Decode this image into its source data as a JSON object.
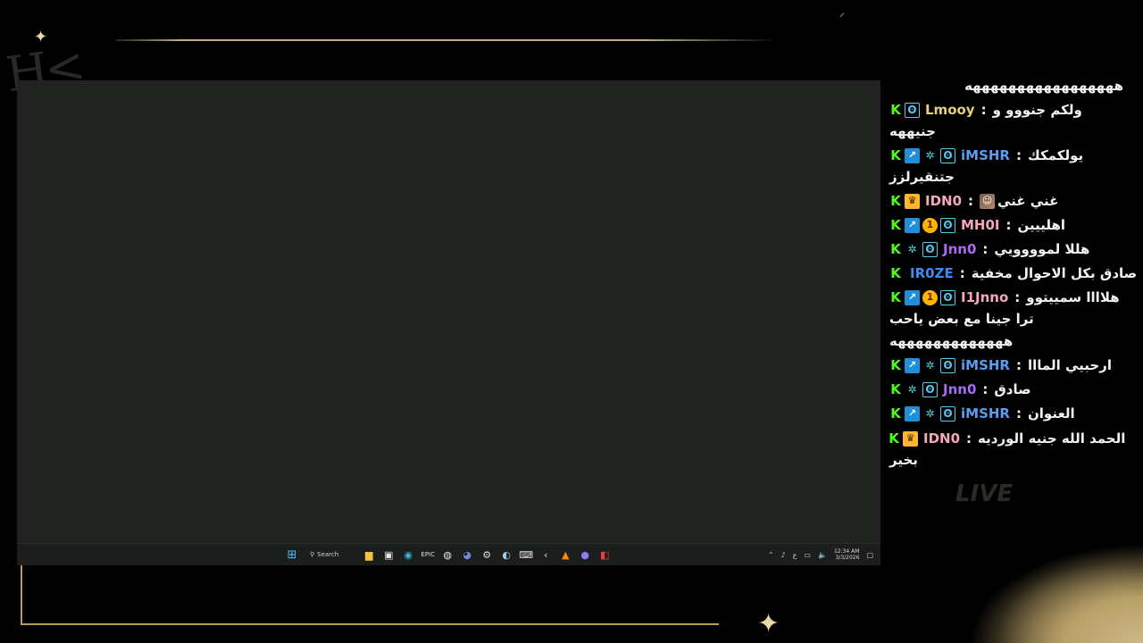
{
  "colors": {
    "kick_green": "#53fc18",
    "gold_frame": "#b59a5b",
    "desktop_bg": "#202320",
    "Lmooy": "#e8d07a",
    "iMSHR": "#5b9bf0",
    "IDN0": "#f4a8b8",
    "MH0I": "#f4a8b8",
    "Jnn0": "#a86bf2",
    "IR0ZE": "#3d8af2",
    "I1Jnno": "#f4a8b8"
  },
  "overlay": {
    "live_text": "LIVE"
  },
  "taskbar": {
    "search_label": "Search",
    "clock_time": "12:34 AM",
    "clock_date": "3/3/2026",
    "lang": "ع"
  },
  "chat": {
    "top_line": "هههههههههههههههههه",
    "messages": [
      {
        "user": "Lmooy",
        "text": "ولكم جنووو و",
        "cont": "جنيههه"
      },
      {
        "user": "iMSHR",
        "text": "يولكمكك",
        "cont": "جتنقيرلزز"
      },
      {
        "user": "IDN0",
        "text": "غني غني"
      },
      {
        "user": "MH0I",
        "text": "اهلييين"
      },
      {
        "user": "Jnn0",
        "text": "هللا لموووويي"
      },
      {
        "user": "IR0ZE",
        "text": "صادق بكل الاحوال مخفية"
      },
      {
        "user": "I1Jnno",
        "text": "هلاااا سمييتوو",
        "cont": "ترا جينا مع بعض ياحب",
        "cont2": "هههههههههههههه"
      },
      {
        "user": "iMSHR",
        "text": "ارحبيي المااا"
      },
      {
        "user": "Jnn0",
        "text": "صادق"
      },
      {
        "user": "iMSHR",
        "text": "العنوان"
      },
      {
        "user": "IDN0",
        "text": "الحمد الله جنيه الورديه",
        "cont": "بخير"
      }
    ]
  }
}
